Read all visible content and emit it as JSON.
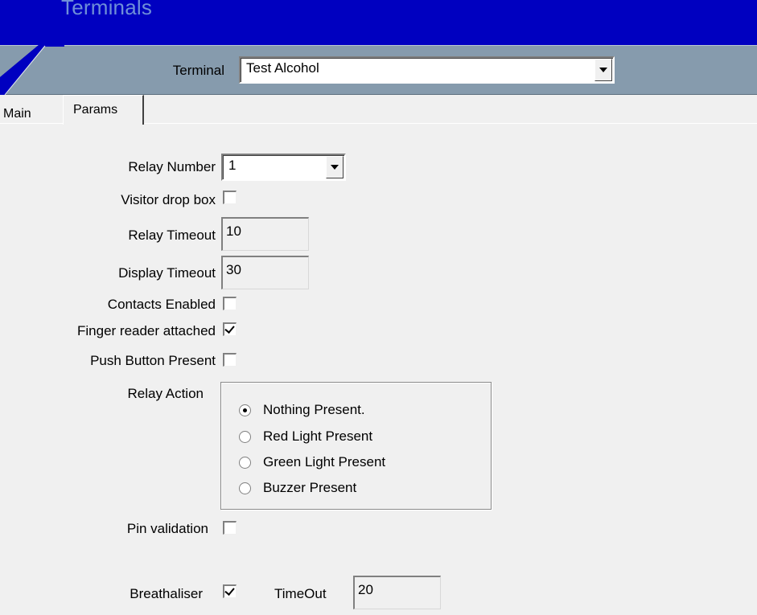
{
  "header": {
    "app_title": "Terminals",
    "terminal_label": "Terminal",
    "terminal_value": "Test Alcohol"
  },
  "tabs": [
    {
      "label": "Main"
    },
    {
      "label": "Params"
    }
  ],
  "form": {
    "relay_number": {
      "label": "Relay Number",
      "value": "1"
    },
    "visitor_drop_box": {
      "label": "Visitor drop box",
      "checked": false
    },
    "relay_timeout": {
      "label": "Relay Timeout",
      "value": "10"
    },
    "display_timeout": {
      "label": "Display Timeout",
      "value": "30"
    },
    "contacts_enabled": {
      "label": "Contacts Enabled",
      "checked": false
    },
    "finger_reader_attached": {
      "label": "Finger reader attached",
      "checked": true
    },
    "push_button_present": {
      "label": "Push Button Present",
      "checked": false
    },
    "relay_action": {
      "label": "Relay Action",
      "options": [
        {
          "label": "Nothing Present.",
          "selected": true
        },
        {
          "label": "Red Light Present",
          "selected": false
        },
        {
          "label": "Green Light Present",
          "selected": false
        },
        {
          "label": "Buzzer Present",
          "selected": false
        }
      ]
    },
    "pin_validation": {
      "label": "Pin validation",
      "checked": false
    },
    "breathaliser": {
      "label": "Breathaliser",
      "checked": true
    },
    "timeout": {
      "label": "TimeOut",
      "value": "20"
    }
  },
  "colors": {
    "header_dark": "#0000c0",
    "header_band": "#869bad",
    "window_bg": "#f0f0f0"
  }
}
